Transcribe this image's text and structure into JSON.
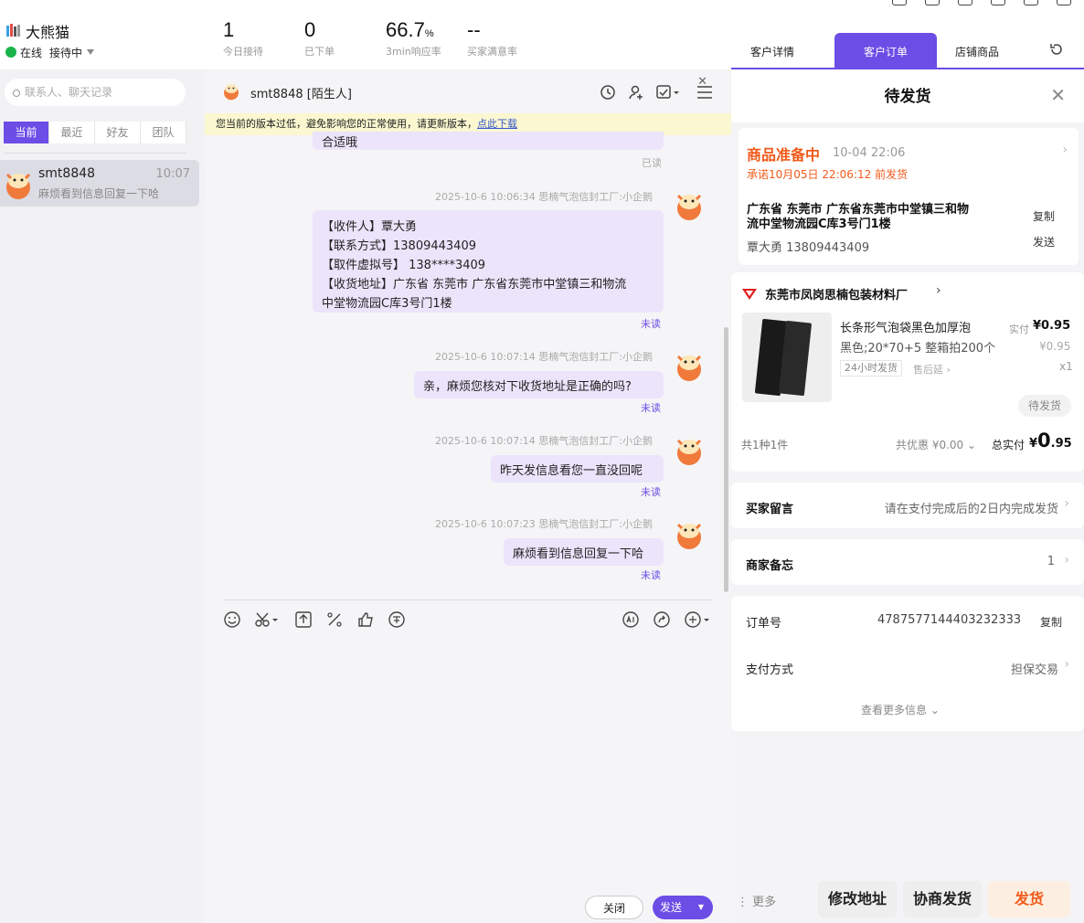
{
  "header": {
    "shop_name": "大熊猫",
    "status_online": "在线",
    "status_mode": "接待中",
    "stats": [
      {
        "value": "1",
        "unit": "",
        "label": "今日接待"
      },
      {
        "value": "0",
        "unit": "",
        "label": "已下单"
      },
      {
        "value": "66.7",
        "unit": "%",
        "label": "3min响应率"
      },
      {
        "value": "--",
        "unit": "",
        "label": "买家满意率"
      }
    ]
  },
  "right_tabs": [
    "客户详情",
    "客户订单",
    "店铺商品"
  ],
  "sidebar": {
    "search_placeholder": "联系人、聊天记录",
    "tabs": [
      "当前",
      "最近",
      "好友",
      "团队"
    ],
    "contact": {
      "name": "smt8848",
      "time": "10:07",
      "preview": "麻烦看到信息回复一下哈"
    }
  },
  "chat": {
    "title": "smt8848",
    "title_tag": "[陌生人]",
    "banner_text": "您当前的版本过低，避免影响您的正常使用，请更新版本，",
    "banner_link": "点此下载",
    "messages": {
      "m0": {
        "text": "合适哦",
        "read": "已读"
      },
      "m1": {
        "meta": "2025-10-6 10:06:34 思楠气泡信封工厂:小企鹅",
        "lines": [
          "【收件人】覃大勇",
          "【联系方式】13809443409",
          "【取件虚拟号】 138****3409",
          "【收货地址】广东省 东莞市 广东省东莞市中堂镇三和物流",
          "中堂物流园C库3号门1楼"
        ],
        "read": "未读"
      },
      "m2": {
        "meta": "2025-10-6 10:07:14 思楠气泡信封工厂:小企鹅",
        "text": "亲，麻烦您核对下收货地址是正确的吗?",
        "read": "未读"
      },
      "m3": {
        "meta": "2025-10-6 10:07:14 思楠气泡信封工厂:小企鹅",
        "text": "昨天发信息看您一直没回呢",
        "read": "未读"
      },
      "m4": {
        "meta": "2025-10-6 10:07:23 思楠气泡信封工厂:小企鹅",
        "text": "麻烦看到信息回复一下哈",
        "read": "未读"
      }
    },
    "close_label": "关闭",
    "send_label": "发送"
  },
  "order": {
    "panel_title": "待发货",
    "prep_status": "商品准备中",
    "prep_time": "10-04 22:06",
    "promise": "承诺10月05日 22:06:12 前发货",
    "address_line1": "广东省 东莞市 广东省东莞市中堂镇三和物",
    "address_line2": "流中堂物流园C库3号门1楼",
    "receiver": "覃大勇 13809443409",
    "copy_label": "复制",
    "send_label": "发送",
    "store_name": "东莞市凤岗思楠包装材料厂",
    "product_name": "长条形气泡袋黑色加厚泡",
    "product_spec": "黑色;20*70+5 整箱拍200个",
    "paid_label": "实付",
    "paid_price": "¥0.95",
    "orig_price": "¥0.95",
    "qty": "x1",
    "tag_24h": "24小时发货",
    "tag_after": "售后延",
    "item_status": "待发货",
    "summary_count": "共1种1件",
    "discount": "共优惠 ¥0.00",
    "total_label": "总实付",
    "total_currency": "¥",
    "total_int": "0",
    "total_dec": ".95",
    "buyer_msg_label": "买家留言",
    "buyer_msg": "请在支付完成后的2日内完成发货",
    "memo_label": "商家备忘",
    "memo_value": "1",
    "order_no_label": "订单号",
    "order_no": "4787577144403232333",
    "pay_label": "支付方式",
    "pay_value": "担保交易",
    "more_info": "查看更多信息"
  },
  "bottom": {
    "more": "更多",
    "edit_addr": "修改地址",
    "negotiate": "协商发货",
    "ship": "发货"
  },
  "colors": {
    "accent": "#6c4de6",
    "orange": "#f05a1a",
    "banner": "#fbf7d0"
  }
}
